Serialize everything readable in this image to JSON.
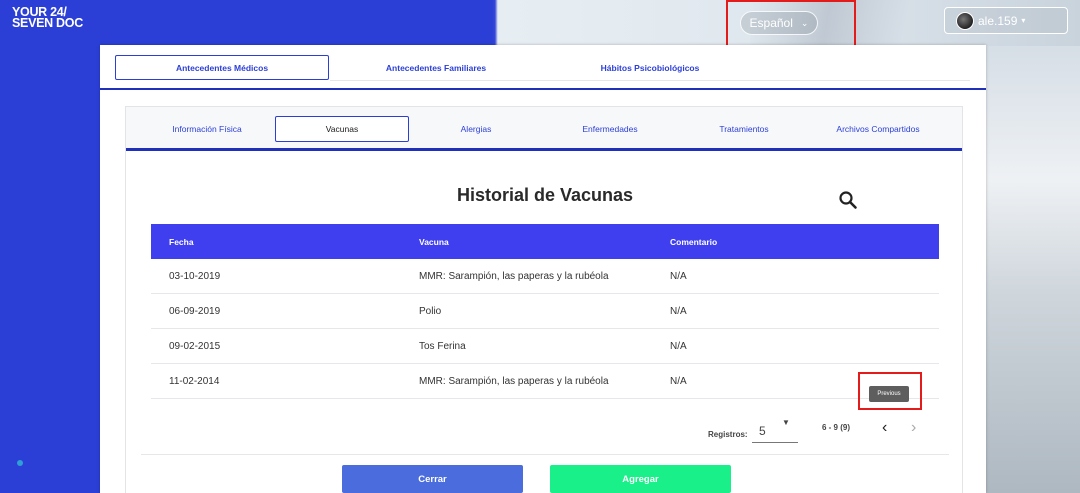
{
  "logo": {
    "line1": "YOUR 24/",
    "line2": "SEVEN DOC"
  },
  "header": {
    "language": "Español",
    "user": "ale.159"
  },
  "main_tabs": [
    {
      "label": "Antecedentes Médicos",
      "active": true
    },
    {
      "label": "Antecedentes Familiares",
      "active": false
    },
    {
      "label": "Hábitos Psicobiológicos",
      "active": false
    }
  ],
  "sub_tabs": [
    {
      "label": "Información Física",
      "active": false
    },
    {
      "label": "Vacunas",
      "active": true
    },
    {
      "label": "Alergias",
      "active": false
    },
    {
      "label": "Enfermedades",
      "active": false
    },
    {
      "label": "Tratamientos",
      "active": false
    },
    {
      "label": "Archivos Compartidos",
      "active": false
    }
  ],
  "section_title": "Historial de Vacunas",
  "table": {
    "columns": [
      "Fecha",
      "Vacuna",
      "Comentario"
    ],
    "rows": [
      [
        "03-10-2019",
        "MMR: Sarampión, las paperas y la rubéola",
        "N/A"
      ],
      [
        "06-09-2019",
        "Polio",
        "N/A"
      ],
      [
        "09-02-2015",
        "Tos Ferina",
        "N/A"
      ],
      [
        "11-02-2014",
        "MMR: Sarampión, las paperas y la rubéola",
        "N/A"
      ]
    ]
  },
  "pagination": {
    "label": "Registros:",
    "per_page": "5",
    "range": "6 - 9 (9)",
    "prev_tooltip": "Previous"
  },
  "buttons": {
    "close": "Cerrar",
    "add": "Agregar"
  },
  "colors": {
    "primary": "#2b3fd6",
    "table_header": "#3f3ff0",
    "add": "#19f089",
    "close": "#4a6cdc",
    "highlight": "#e31b1b"
  }
}
